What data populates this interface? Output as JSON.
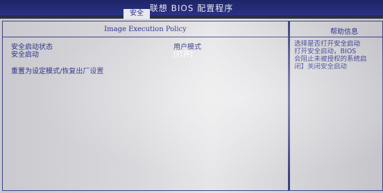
{
  "window": {
    "title": "联想 BIOS 配置程序",
    "active_tab": "安全"
  },
  "main_panel": {
    "title": "Image Execution Policy",
    "rows": [
      {
        "label": "安全启动状态",
        "value": "用户模式"
      },
      {
        "label": "安全启动",
        "value": "[打开]"
      }
    ],
    "action": "重置为设定模式/恢复出厂设置"
  },
  "help_panel": {
    "title": "帮助信息",
    "lines": [
      "选择是否打开安全启动",
      "打开安全启动，BIOS",
      "会阻止未被授权的系统启",
      "闭】关闭安全启动"
    ]
  },
  "colors": {
    "header_bg": "#1e2566",
    "panel_bg": "#d8d8dc",
    "text": "#2e3388",
    "selected_text": "#ffffff"
  }
}
